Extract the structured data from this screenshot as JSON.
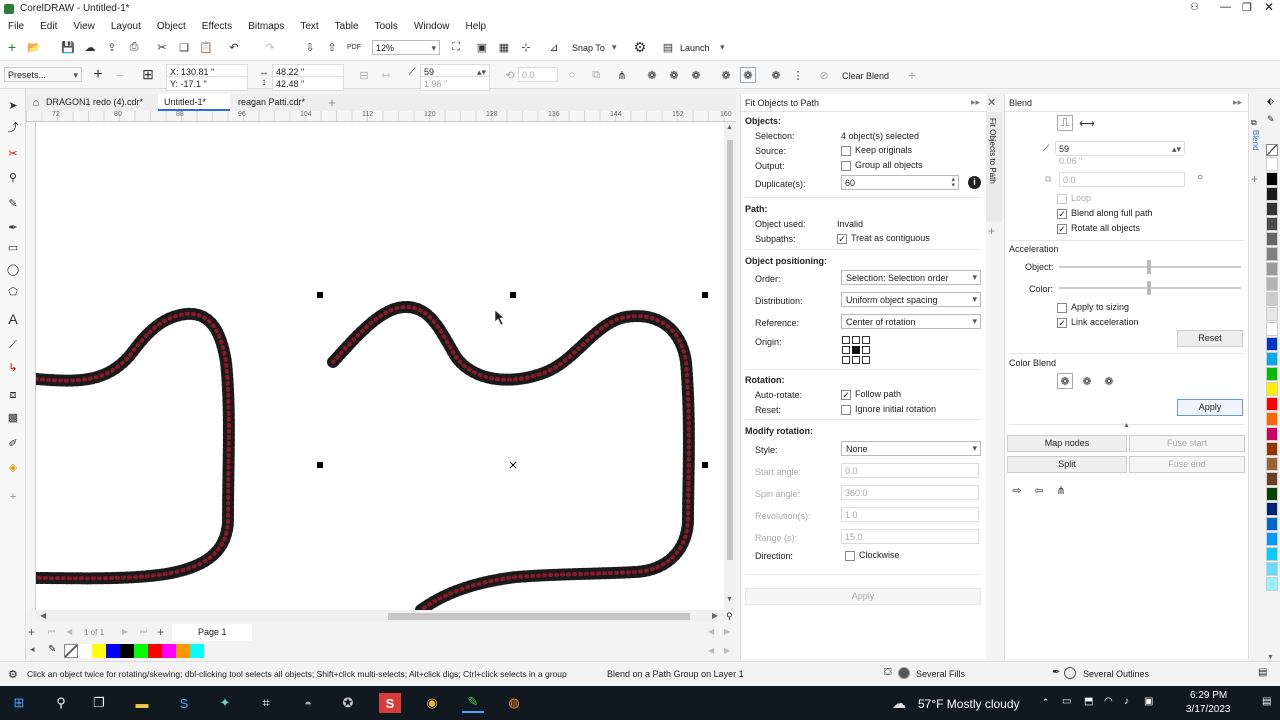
{
  "window": {
    "title": "CorelDRAW - Untitled-1*"
  },
  "menu": [
    "File",
    "Edit",
    "View",
    "Layout",
    "Object",
    "Effects",
    "Bitmaps",
    "Text",
    "Table",
    "Tools",
    "Window",
    "Help"
  ],
  "stdbar": {
    "zoom": "12%",
    "snap_label": "Snap To",
    "launch_label": "Launch"
  },
  "propbar": {
    "presets": "Presets...",
    "x": "X: 130.81 \"",
    "y": "Y: -17.1 \"",
    "w": "48.22 \"",
    "h": "42.48 \"",
    "steps": "59",
    "spacing": "1.96 \"",
    "rotation": "0.0",
    "clear_blend": "Clear Blend"
  },
  "doc_tabs": [
    "DRAGON1 redo (4).cdr*",
    "Untitled-1*",
    "reagan Patti.cdr*"
  ],
  "ruler_numbers": [
    "72",
    "80",
    "88",
    "96",
    "104",
    "112",
    "120",
    "128",
    "136",
    "144",
    "152",
    "160"
  ],
  "pagebar": {
    "page_count": "1 of 1",
    "page_label": "Page 1"
  },
  "palette_colors": [
    "#ffffff",
    "#ffff00",
    "#0000ff",
    "#000000",
    "#00ff00",
    "#ff0000",
    "#ff00ff",
    "#ff9900",
    "#00ffff"
  ],
  "fit": {
    "title": "Fit Objects to Path",
    "vtab": "Fit Objects to Path",
    "objects_h": "Objects:",
    "selection_l": "Selection:",
    "selection_v": "4 object(s) selected",
    "source_l": "Source:",
    "source_v": "Keep originals",
    "output_l": "Output:",
    "output_v": "Group all objects",
    "duplicates_l": "Duplicate(s):",
    "duplicates_v": "60",
    "path_h": "Path:",
    "objused_l": "Object used:",
    "objused_v": "Invalid",
    "subpaths_l": "Subpaths:",
    "subpaths_v": "Treat as contiguous",
    "pos_h": "Object positioning:",
    "order_l": "Order:",
    "order_v": "Selection: Selection order",
    "dist_l": "Distribution:",
    "dist_v": "Uniform object spacing",
    "ref_l": "Reference:",
    "ref_v": "Center of rotation",
    "origin_l": "Origin:",
    "rot_h": "Rotation:",
    "autorot_l": "Auto-rotate:",
    "autorot_v": "Follow path",
    "reset_l": "Reset:",
    "reset_v": "Ignore initial rotation",
    "modrot_h": "Modify rotation:",
    "style_l": "Style:",
    "style_v": "None",
    "start_l": "Start angle:",
    "start_v": "0.0",
    "spin_l": "Spin angle:",
    "spin_v": "360.0",
    "rev_l": "Revolution(s):",
    "rev_v": "1.0",
    "range_l": "Range (s):",
    "range_v": "15.0",
    "dir_l": "Direction:",
    "dir_v": "Clockwise",
    "apply": "Apply"
  },
  "blend": {
    "title": "Blend",
    "vtab": "Blend",
    "steps": "59",
    "spacing": "0.06 \"",
    "rotation": "0.0",
    "loop": "Loop",
    "along_path": "Blend along full path",
    "rotate_all": "Rotate all objects",
    "accel_h": "Acceleration",
    "object_l": "Object:",
    "color_l": "Color:",
    "apply_sizing": "Apply to sizing",
    "link_accel": "Link acceleration",
    "reset": "Reset",
    "color_blend_h": "Color Blend",
    "apply": "Apply",
    "map_nodes": "Map nodes",
    "fuse_start": "Fuse start",
    "split": "Split",
    "fuse_end": "Fuse end"
  },
  "colpal": [
    "#ffffff",
    "#000000",
    "#1a1a1a",
    "#333333",
    "#4d4d4d",
    "#666666",
    "#808080",
    "#999999",
    "#b3b3b3",
    "#cccccc",
    "#e6e6e6",
    "#ffffff",
    "#0033cc",
    "#00aaee",
    "#00bb00",
    "#ffee00",
    "#ff0000",
    "#ff6600",
    "#cc0066",
    "#993300",
    "#996633",
    "#6b3f23",
    "#004400",
    "#002277",
    "#0066cc",
    "#0099ff",
    "#00ccff",
    "#66ddff",
    "#99eeff"
  ],
  "status": {
    "hint": "Click an object twice for rotating/skewing; dbl-clicking tool selects all objects; Shift+click multi-selects; Alt+click digs; Ctrl+click selects in a group",
    "layer": "Blend on a Path Group on Layer 1",
    "fills": "Several Fills",
    "outlines": "Several Outlines"
  },
  "taskbar": {
    "weather": "57°F  Mostly cloudy",
    "time": "6:29 PM",
    "date": "3/17/2023"
  }
}
